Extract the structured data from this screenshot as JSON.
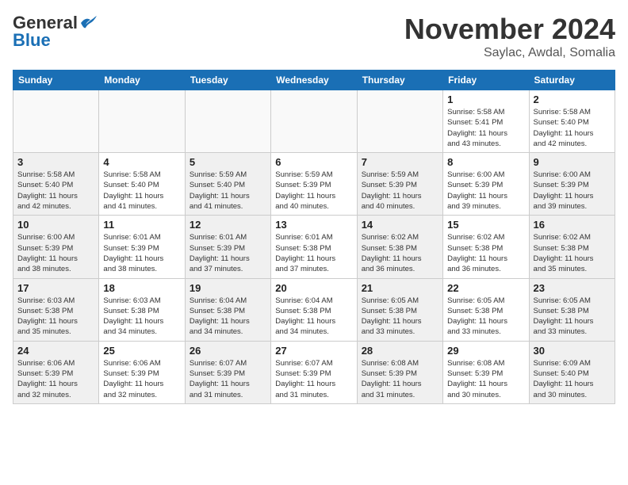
{
  "header": {
    "logo_line1": "General",
    "logo_line2": "Blue",
    "month_title": "November 2024",
    "subtitle": "Saylac, Awdal, Somalia"
  },
  "weekdays": [
    "Sunday",
    "Monday",
    "Tuesday",
    "Wednesday",
    "Thursday",
    "Friday",
    "Saturday"
  ],
  "weeks": [
    [
      {
        "day": "",
        "info": "",
        "shaded": true
      },
      {
        "day": "",
        "info": "",
        "shaded": true
      },
      {
        "day": "",
        "info": "",
        "shaded": true
      },
      {
        "day": "",
        "info": "",
        "shaded": true
      },
      {
        "day": "",
        "info": "",
        "shaded": true
      },
      {
        "day": "1",
        "info": "Sunrise: 5:58 AM\nSunset: 5:41 PM\nDaylight: 11 hours\nand 43 minutes.",
        "shaded": false
      },
      {
        "day": "2",
        "info": "Sunrise: 5:58 AM\nSunset: 5:40 PM\nDaylight: 11 hours\nand 42 minutes.",
        "shaded": false
      }
    ],
    [
      {
        "day": "3",
        "info": "Sunrise: 5:58 AM\nSunset: 5:40 PM\nDaylight: 11 hours\nand 42 minutes.",
        "shaded": true
      },
      {
        "day": "4",
        "info": "Sunrise: 5:58 AM\nSunset: 5:40 PM\nDaylight: 11 hours\nand 41 minutes.",
        "shaded": false
      },
      {
        "day": "5",
        "info": "Sunrise: 5:59 AM\nSunset: 5:40 PM\nDaylight: 11 hours\nand 41 minutes.",
        "shaded": true
      },
      {
        "day": "6",
        "info": "Sunrise: 5:59 AM\nSunset: 5:39 PM\nDaylight: 11 hours\nand 40 minutes.",
        "shaded": false
      },
      {
        "day": "7",
        "info": "Sunrise: 5:59 AM\nSunset: 5:39 PM\nDaylight: 11 hours\nand 40 minutes.",
        "shaded": true
      },
      {
        "day": "8",
        "info": "Sunrise: 6:00 AM\nSunset: 5:39 PM\nDaylight: 11 hours\nand 39 minutes.",
        "shaded": false
      },
      {
        "day": "9",
        "info": "Sunrise: 6:00 AM\nSunset: 5:39 PM\nDaylight: 11 hours\nand 39 minutes.",
        "shaded": true
      }
    ],
    [
      {
        "day": "10",
        "info": "Sunrise: 6:00 AM\nSunset: 5:39 PM\nDaylight: 11 hours\nand 38 minutes.",
        "shaded": true
      },
      {
        "day": "11",
        "info": "Sunrise: 6:01 AM\nSunset: 5:39 PM\nDaylight: 11 hours\nand 38 minutes.",
        "shaded": false
      },
      {
        "day": "12",
        "info": "Sunrise: 6:01 AM\nSunset: 5:39 PM\nDaylight: 11 hours\nand 37 minutes.",
        "shaded": true
      },
      {
        "day": "13",
        "info": "Sunrise: 6:01 AM\nSunset: 5:38 PM\nDaylight: 11 hours\nand 37 minutes.",
        "shaded": false
      },
      {
        "day": "14",
        "info": "Sunrise: 6:02 AM\nSunset: 5:38 PM\nDaylight: 11 hours\nand 36 minutes.",
        "shaded": true
      },
      {
        "day": "15",
        "info": "Sunrise: 6:02 AM\nSunset: 5:38 PM\nDaylight: 11 hours\nand 36 minutes.",
        "shaded": false
      },
      {
        "day": "16",
        "info": "Sunrise: 6:02 AM\nSunset: 5:38 PM\nDaylight: 11 hours\nand 35 minutes.",
        "shaded": true
      }
    ],
    [
      {
        "day": "17",
        "info": "Sunrise: 6:03 AM\nSunset: 5:38 PM\nDaylight: 11 hours\nand 35 minutes.",
        "shaded": true
      },
      {
        "day": "18",
        "info": "Sunrise: 6:03 AM\nSunset: 5:38 PM\nDaylight: 11 hours\nand 34 minutes.",
        "shaded": false
      },
      {
        "day": "19",
        "info": "Sunrise: 6:04 AM\nSunset: 5:38 PM\nDaylight: 11 hours\nand 34 minutes.",
        "shaded": true
      },
      {
        "day": "20",
        "info": "Sunrise: 6:04 AM\nSunset: 5:38 PM\nDaylight: 11 hours\nand 34 minutes.",
        "shaded": false
      },
      {
        "day": "21",
        "info": "Sunrise: 6:05 AM\nSunset: 5:38 PM\nDaylight: 11 hours\nand 33 minutes.",
        "shaded": true
      },
      {
        "day": "22",
        "info": "Sunrise: 6:05 AM\nSunset: 5:38 PM\nDaylight: 11 hours\nand 33 minutes.",
        "shaded": false
      },
      {
        "day": "23",
        "info": "Sunrise: 6:05 AM\nSunset: 5:38 PM\nDaylight: 11 hours\nand 33 minutes.",
        "shaded": true
      }
    ],
    [
      {
        "day": "24",
        "info": "Sunrise: 6:06 AM\nSunset: 5:39 PM\nDaylight: 11 hours\nand 32 minutes.",
        "shaded": true
      },
      {
        "day": "25",
        "info": "Sunrise: 6:06 AM\nSunset: 5:39 PM\nDaylight: 11 hours\nand 32 minutes.",
        "shaded": false
      },
      {
        "day": "26",
        "info": "Sunrise: 6:07 AM\nSunset: 5:39 PM\nDaylight: 11 hours\nand 31 minutes.",
        "shaded": true
      },
      {
        "day": "27",
        "info": "Sunrise: 6:07 AM\nSunset: 5:39 PM\nDaylight: 11 hours\nand 31 minutes.",
        "shaded": false
      },
      {
        "day": "28",
        "info": "Sunrise: 6:08 AM\nSunset: 5:39 PM\nDaylight: 11 hours\nand 31 minutes.",
        "shaded": true
      },
      {
        "day": "29",
        "info": "Sunrise: 6:08 AM\nSunset: 5:39 PM\nDaylight: 11 hours\nand 30 minutes.",
        "shaded": false
      },
      {
        "day": "30",
        "info": "Sunrise: 6:09 AM\nSunset: 5:40 PM\nDaylight: 11 hours\nand 30 minutes.",
        "shaded": true
      }
    ]
  ]
}
